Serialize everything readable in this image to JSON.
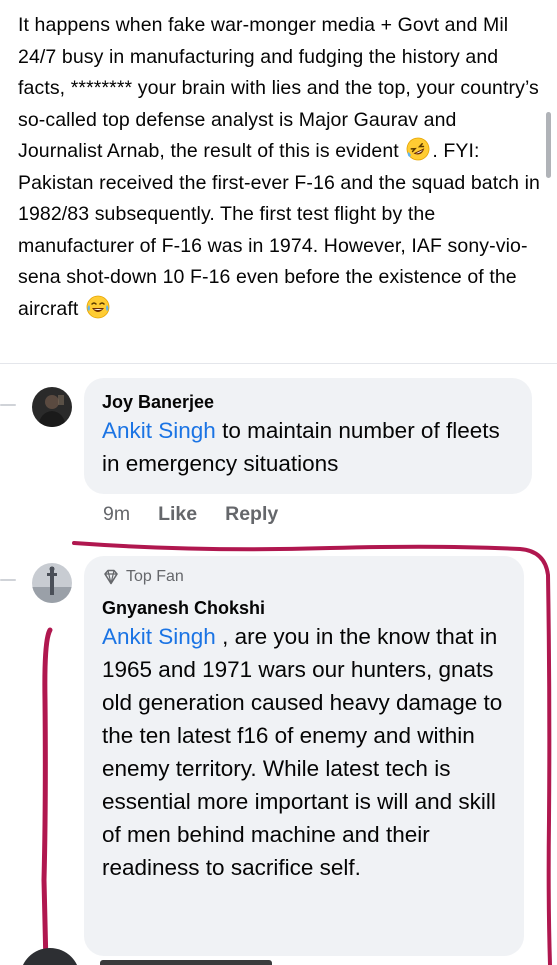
{
  "post": {
    "text_part1": "It happens when fake war-monger media + Govt and Mil 24/7 busy in manufacturing and fudging the history and facts, ******** your brain with lies and the top, your country’s so-called top defense analyst is Major Gaurav and Journalist Arnab, the result of this is evident",
    "emoji1": "rolling-on-floor-laughing-emoji",
    "text_part2": ". FYI: Pakistan received the first-ever F-16 and the squad batch in 1982/83 subsequently. The first test flight by the manufacturer of F-16 was in 1974. However, IAF sony-vio-sena shot-down 10 F-16 even before the existence of the aircraft",
    "emoji2": "tears-of-joy-emoji"
  },
  "comments": [
    {
      "author": "Joy Banerjee",
      "mention": "Ankit Singh",
      "text": " to maintain number of fleets in emergency situations",
      "time": "9m",
      "like_label": "Like",
      "reply_label": "Reply"
    },
    {
      "badge": "Top Fan",
      "author": "Gnyanesh Chokshi",
      "mention": "Ankit Singh",
      "text": " , are you in the know that in 1965 and 1971 wars our hunters, gnats old generation caused heavy damage to the ten latest f16 of enemy and within enemy territory. While latest tech is essential more important is will and skill of men behind machine and their readiness to sacrifice self."
    }
  ],
  "colors": {
    "mention": "#1b74e4",
    "bubble": "#f0f2f5",
    "annotation": "#b0174f"
  }
}
